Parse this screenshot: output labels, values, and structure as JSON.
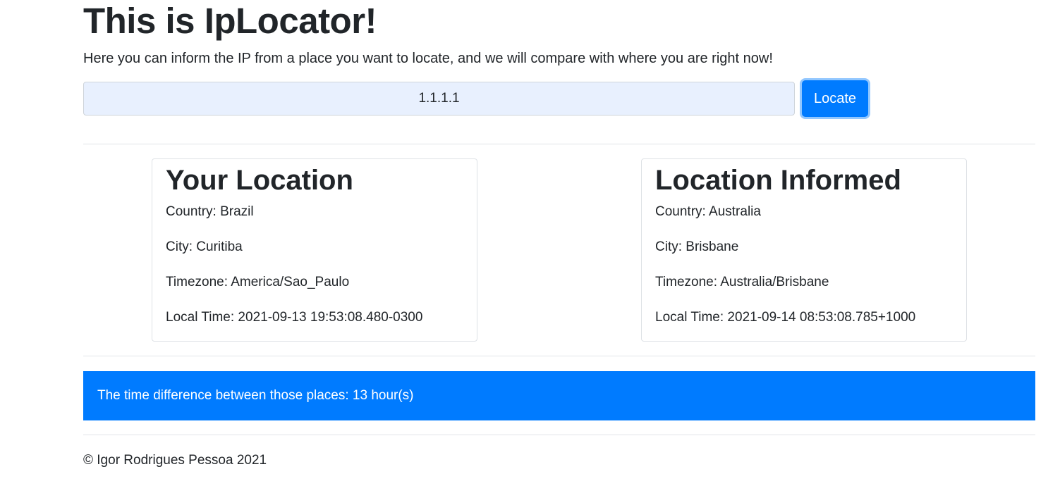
{
  "header": {
    "title": "This is IpLocator!",
    "lead": "Here you can inform the IP from a place you want to locate, and we will compare with where you are right now!"
  },
  "search": {
    "value": "1.1.1.1",
    "button_label": "Locate"
  },
  "your_location": {
    "heading": "Your Location",
    "country": "Country: Brazil",
    "city": "City: Curitiba",
    "timezone": "Timezone: America/Sao_Paulo",
    "local_time": "Local Time: 2021-09-13 19:53:08.480-0300"
  },
  "location_informed": {
    "heading": "Location Informed",
    "country": "Country: Australia",
    "city": "City: Brisbane",
    "timezone": "Timezone: Australia/Brisbane",
    "local_time": "Local Time: 2021-09-14 08:53:08.785+1000"
  },
  "result": {
    "message": "The time difference between those places: 13 hour(s)"
  },
  "footer": {
    "copyright": "© Igor Rodrigues Pessoa 2021"
  },
  "colors": {
    "primary": "#007bff",
    "input_bg": "#e8f0fe",
    "text": "#212529"
  }
}
